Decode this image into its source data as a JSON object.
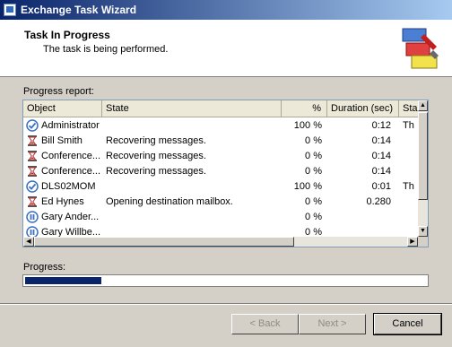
{
  "window": {
    "title": "Exchange Task Wizard"
  },
  "header": {
    "title": "Task In Progress",
    "subtitle": "The task is being performed."
  },
  "progress_report": {
    "label": "Progress report:",
    "columns": [
      "Object",
      "State",
      "%",
      "Duration (sec)",
      "Sta"
    ],
    "rows": [
      {
        "icon": "check-circle-icon",
        "object": "Administrator",
        "state": "",
        "percent": "100 %",
        "duration": "0:12",
        "status": "Th"
      },
      {
        "icon": "hourglass-icon",
        "object": "Bill Smith",
        "state": "Recovering messages.",
        "percent": "0 %",
        "duration": "0:14",
        "status": ""
      },
      {
        "icon": "hourglass-icon",
        "object": "Conference...",
        "state": "Recovering messages.",
        "percent": "0 %",
        "duration": "0:14",
        "status": ""
      },
      {
        "icon": "hourglass-icon",
        "object": "Conference...",
        "state": "Recovering messages.",
        "percent": "0 %",
        "duration": "0:14",
        "status": ""
      },
      {
        "icon": "check-circle-icon",
        "object": "DLS02MOM",
        "state": "",
        "percent": "100 %",
        "duration": "0:01",
        "status": "Th"
      },
      {
        "icon": "hourglass-icon",
        "object": "Ed Hynes",
        "state": "Opening destination mailbox.",
        "percent": "0 %",
        "duration": "0.280",
        "status": ""
      },
      {
        "icon": "pause-circle-icon",
        "object": "Gary Ander...",
        "state": "",
        "percent": "0 %",
        "duration": "",
        "status": ""
      },
      {
        "icon": "pause-circle-icon",
        "object": "Gary Willbe...",
        "state": "",
        "percent": "0 %",
        "duration": "",
        "status": ""
      }
    ]
  },
  "progress": {
    "label": "Progress:",
    "fraction": 0.19
  },
  "buttons": {
    "back": "< Back",
    "next": "Next >",
    "cancel": "Cancel"
  },
  "colors": {
    "accent": "#0a246a",
    "check": "#3a6fc4",
    "hourglass": "#b03030"
  }
}
